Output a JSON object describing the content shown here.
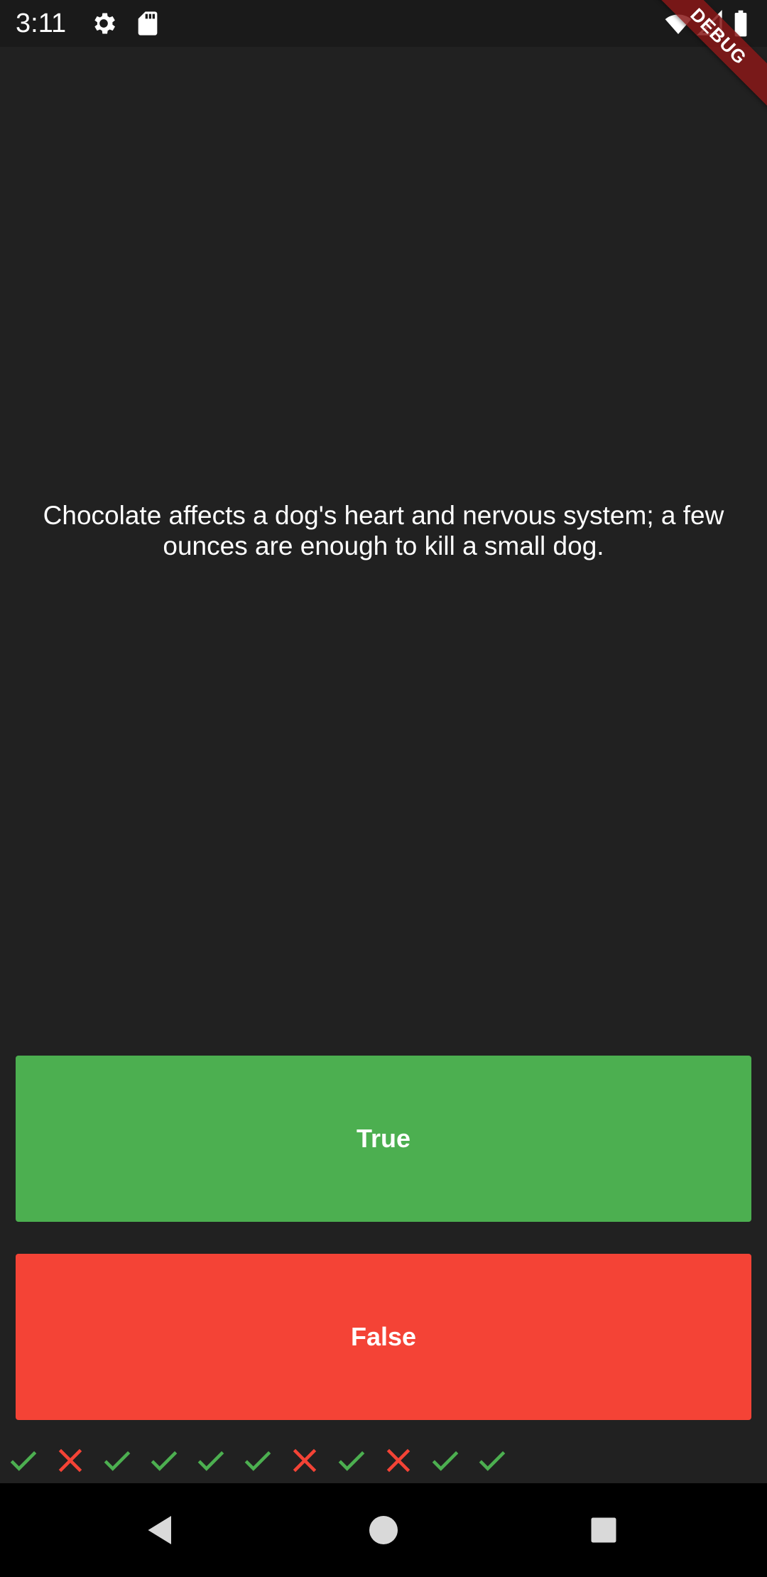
{
  "status_bar": {
    "time": "3:11",
    "icons": [
      "gear-icon",
      "sd-card-icon",
      "wifi-icon",
      "signal-icon",
      "battery-icon"
    ]
  },
  "debug_banner": {
    "label": "DEBUG",
    "color": "#8b1a1a"
  },
  "question": {
    "text": "Chocolate affects a dog's heart and nervous system; a few ounces are enough to kill a small dog."
  },
  "buttons": {
    "true_label": "True",
    "false_label": "False",
    "true_color": "#4caf50",
    "false_color": "#f44336"
  },
  "score_keeper": {
    "results": [
      "correct",
      "wrong",
      "correct",
      "correct",
      "correct",
      "correct",
      "wrong",
      "correct",
      "wrong",
      "correct",
      "correct"
    ],
    "correct_icon": "check-icon",
    "wrong_icon": "close-icon",
    "correct_color": "#4caf50",
    "wrong_color": "#f44336"
  },
  "nav_bar": {
    "buttons": [
      "back-icon",
      "home-icon",
      "recents-icon"
    ]
  },
  "colors": {
    "background": "#212121",
    "status_bar": "#1a1a1a",
    "nav_bar": "#000000"
  }
}
